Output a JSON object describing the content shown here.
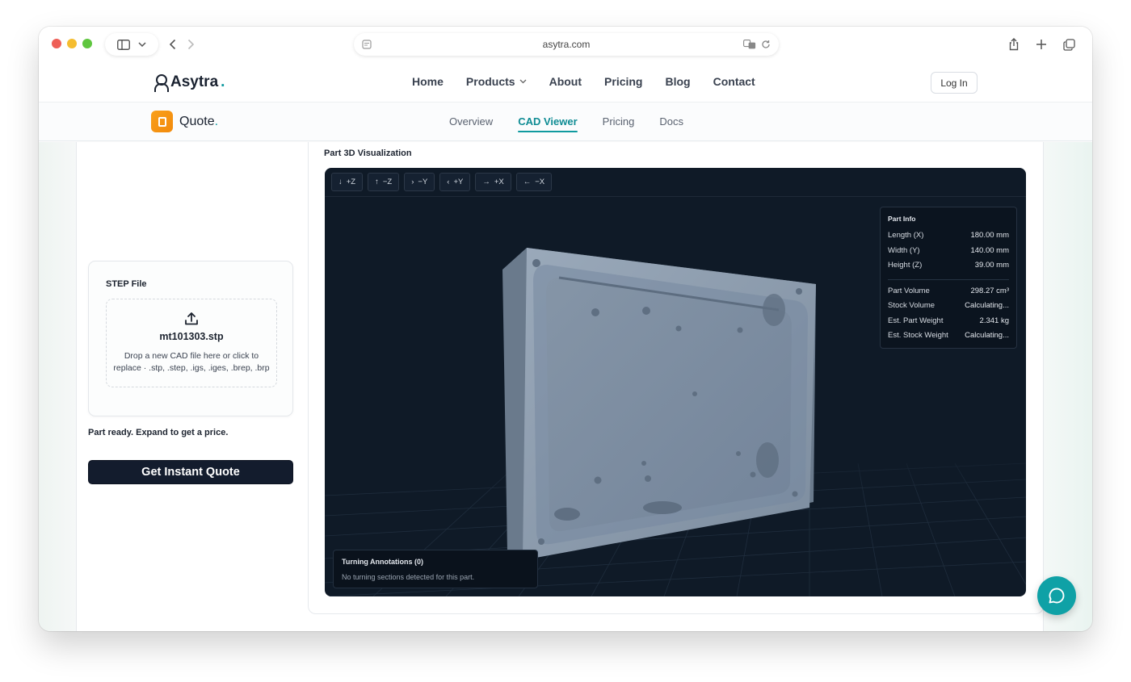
{
  "browser": {
    "url": "asytra.com"
  },
  "header": {
    "brand": "Asytra",
    "brand_dot": ".",
    "nav": [
      "Home",
      "Products",
      "About",
      "Pricing",
      "Blog",
      "Contact"
    ],
    "login_label": "Log In"
  },
  "subheader": {
    "app_name": "Quote",
    "app_dot": ".",
    "tabs": [
      "Overview",
      "CAD Viewer",
      "Pricing",
      "Docs"
    ],
    "active_tab": "CAD Viewer"
  },
  "upload": {
    "title": "STEP File",
    "file_name": "mt101303.stp",
    "help": "Drop a new CAD file here or click to replace · .stp, .step, .igs, .iges, .brep, .brp",
    "status": "Part ready. Expand to get a price.",
    "quote_button": "Get Instant Quote"
  },
  "viewer": {
    "title": "Part 3D Visualization",
    "view_buttons": [
      {
        "arrow": "↓",
        "label": "+Z"
      },
      {
        "arrow": "↑",
        "label": "−Z"
      },
      {
        "arrow": "›",
        "label": "−Y"
      },
      {
        "arrow": "‹",
        "label": "+Y"
      },
      {
        "arrow": "→",
        "label": "+X"
      },
      {
        "arrow": "←",
        "label": "−X"
      }
    ],
    "part_info": {
      "title": "Part Info",
      "dimensions": [
        {
          "label": "Length (X)",
          "value": "180.00 mm"
        },
        {
          "label": "Width (Y)",
          "value": "140.00 mm"
        },
        {
          "label": "Height (Z)",
          "value": "39.00 mm"
        }
      ],
      "metrics": [
        {
          "label": "Part Volume",
          "value": "298.27 cm³"
        },
        {
          "label": "Stock Volume",
          "value": "Calculating..."
        },
        {
          "label": "Est. Part Weight",
          "value": "2.341 kg"
        },
        {
          "label": "Est. Stock Weight",
          "value": "Calculating..."
        }
      ]
    },
    "turning": {
      "title": "Turning Annotations (0)",
      "text": "No turning sections detected for this part."
    }
  },
  "colors": {
    "accent": "#0f9a9f",
    "viewer_bg": "#0f1a27",
    "part": "#8a9aac",
    "button_dark": "#131c2d"
  },
  "icons": {
    "upload": "upload-icon",
    "chat": "chat-bubble-icon"
  }
}
